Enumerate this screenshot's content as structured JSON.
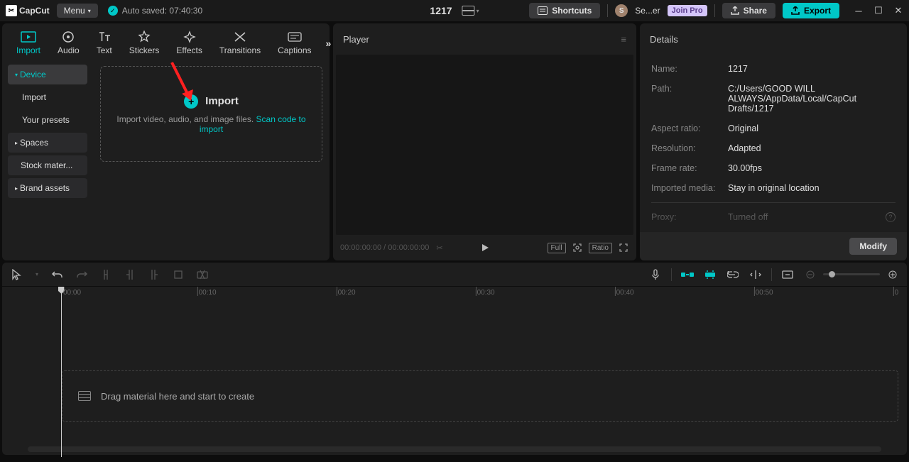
{
  "topbar": {
    "logo": "CapCut",
    "menu_label": "Menu",
    "autosave": "Auto saved: 07:40:30",
    "doc_title": "1217",
    "shortcuts": "Shortcuts",
    "user_short": "Se...er",
    "join_pro": "Join Pro",
    "share": "Share",
    "export": "Export"
  },
  "media_tabs": [
    "Import",
    "Audio",
    "Text",
    "Stickers",
    "Effects",
    "Transitions",
    "Captions"
  ],
  "media_side": {
    "device": "Device",
    "import": "Import",
    "presets": "Your presets",
    "spaces": "Spaces",
    "stock": "Stock mater...",
    "brand": "Brand assets"
  },
  "import_box": {
    "title": "Import",
    "desc_pre": "Import video, audio, and image files. ",
    "scan": "Scan code to import"
  },
  "player": {
    "title": "Player",
    "time_current": "00:00:00:00",
    "time_sep": " / ",
    "time_total": "00:00:00:00",
    "full": "Full",
    "ratio": "Ratio"
  },
  "details": {
    "title": "Details",
    "rows": {
      "name_l": "Name:",
      "name_v": "1217",
      "path_l": "Path:",
      "path_v": "C:/Users/GOOD WILL ALWAYS/AppData/Local/CapCut Drafts/1217",
      "aspect_l": "Aspect ratio:",
      "aspect_v": "Original",
      "res_l": "Resolution:",
      "res_v": "Adapted",
      "fps_l": "Frame rate:",
      "fps_v": "30.00fps",
      "imp_l": "Imported media:",
      "imp_v": "Stay in original location",
      "proxy_l": "Proxy:",
      "proxy_v": "Turned off"
    },
    "modify": "Modify"
  },
  "timeline": {
    "ticks": [
      "00:00",
      "|00:10",
      "|00:20",
      "|00:30",
      "|00:40",
      "|00:50",
      "|0"
    ],
    "drop_hint": "Drag material here and start to create"
  }
}
